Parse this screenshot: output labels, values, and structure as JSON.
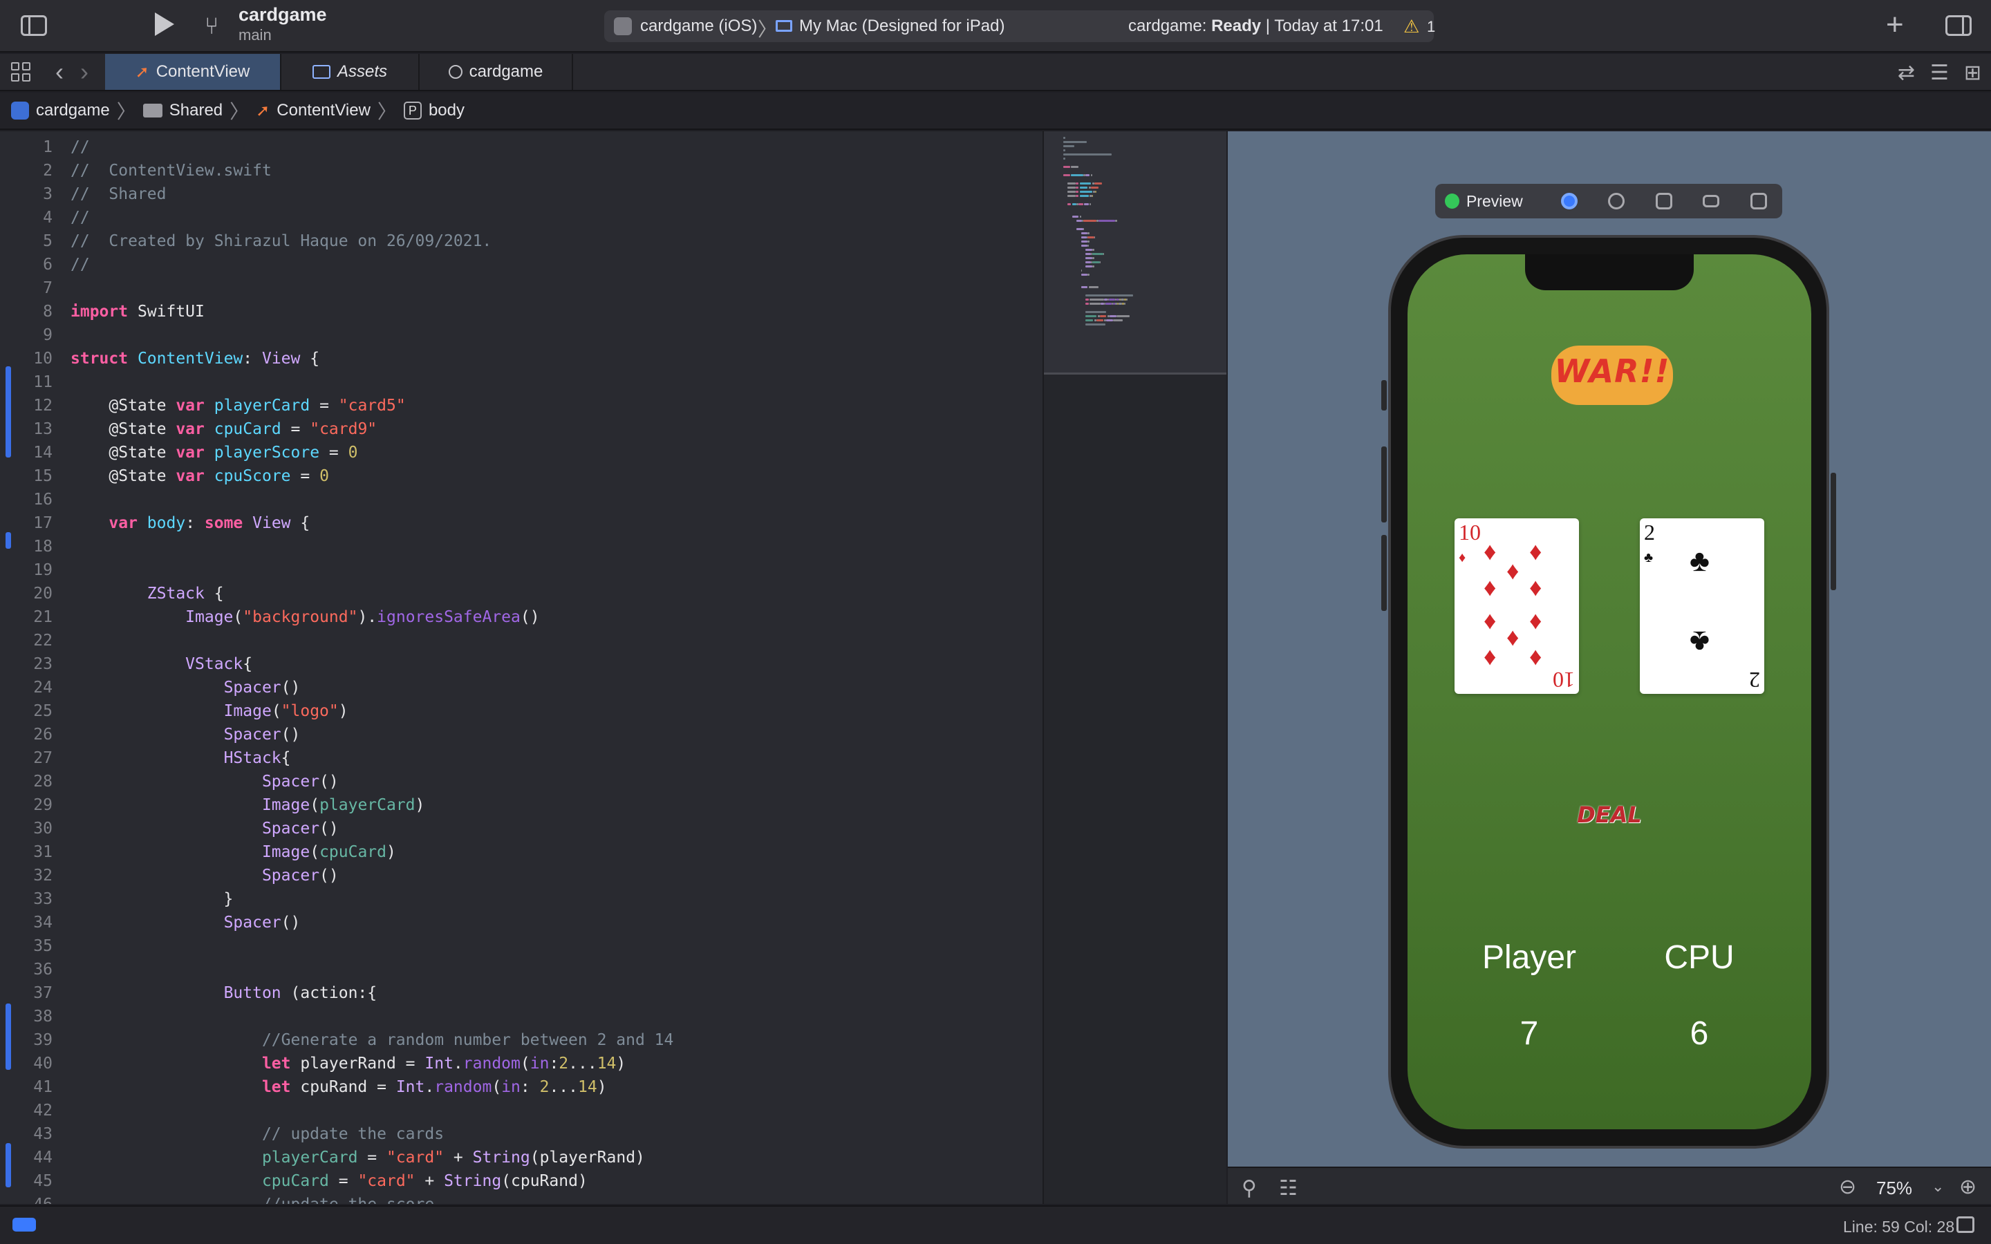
{
  "toolbar": {
    "project": "cardgame",
    "branch": "main",
    "scheme": "cardgame (iOS)",
    "separator": "〉",
    "device": "My Mac (Designed for iPad)",
    "status_prefix": "cardgame: ",
    "status_state": "Ready",
    "status_suffix": " | Today at 17:01",
    "warning_count": "1"
  },
  "tabs": [
    {
      "label": "ContentView",
      "active": true
    },
    {
      "label": "Assets",
      "active": false
    },
    {
      "label": "cardgame",
      "active": false
    }
  ],
  "breadcrumb": [
    "cardgame",
    "Shared",
    "ContentView",
    "body"
  ],
  "breadcrumb_sep": "〉",
  "breadcrumb_p": "P",
  "editor": {
    "lines": [
      [
        {
          "t": "//",
          "c": "cm"
        }
      ],
      [
        {
          "t": "//  ContentView.swift",
          "c": "cm"
        }
      ],
      [
        {
          "t": "//  Shared",
          "c": "cm"
        }
      ],
      [
        {
          "t": "//",
          "c": "cm"
        }
      ],
      [
        {
          "t": "//  Created by Shirazul Haque on 26/09/2021.",
          "c": "cm"
        }
      ],
      [
        {
          "t": "//",
          "c": "cm"
        }
      ],
      [],
      [
        {
          "t": "import",
          "c": "kw"
        },
        {
          "t": " SwiftUI",
          "c": ""
        }
      ],
      [],
      [
        {
          "t": "struct",
          "c": "kw"
        },
        {
          "t": " ",
          "c": ""
        },
        {
          "t": "ContentView",
          "c": "dec"
        },
        {
          "t": ": ",
          "c": ""
        },
        {
          "t": "View",
          "c": "ty"
        },
        {
          "t": " {",
          "c": ""
        }
      ],
      [],
      [
        {
          "t": "    @State ",
          "c": ""
        },
        {
          "t": "var",
          "c": "kw"
        },
        {
          "t": " ",
          "c": ""
        },
        {
          "t": "playerCard",
          "c": "dec"
        },
        {
          "t": " = ",
          "c": ""
        },
        {
          "t": "\"card5\"",
          "c": "str"
        }
      ],
      [
        {
          "t": "    @State ",
          "c": ""
        },
        {
          "t": "var",
          "c": "kw"
        },
        {
          "t": " ",
          "c": ""
        },
        {
          "t": "cpuCard",
          "c": "dec"
        },
        {
          "t": " = ",
          "c": ""
        },
        {
          "t": "\"card9\"",
          "c": "str"
        }
      ],
      [
        {
          "t": "    @State ",
          "c": ""
        },
        {
          "t": "var",
          "c": "kw"
        },
        {
          "t": " ",
          "c": ""
        },
        {
          "t": "playerScore",
          "c": "dec"
        },
        {
          "t": " = ",
          "c": ""
        },
        {
          "t": "0",
          "c": "num"
        }
      ],
      [
        {
          "t": "    @State ",
          "c": ""
        },
        {
          "t": "var",
          "c": "kw"
        },
        {
          "t": " ",
          "c": ""
        },
        {
          "t": "cpuScore",
          "c": "dec"
        },
        {
          "t": " = ",
          "c": ""
        },
        {
          "t": "0",
          "c": "num"
        }
      ],
      [],
      [
        {
          "t": "    ",
          "c": ""
        },
        {
          "t": "var",
          "c": "kw"
        },
        {
          "t": " ",
          "c": ""
        },
        {
          "t": "body",
          "c": "dec"
        },
        {
          "t": ": ",
          "c": ""
        },
        {
          "t": "some",
          "c": "kw"
        },
        {
          "t": " ",
          "c": ""
        },
        {
          "t": "View",
          "c": "ty"
        },
        {
          "t": " {",
          "c": ""
        }
      ],
      [],
      [],
      [
        {
          "t": "        ",
          "c": ""
        },
        {
          "t": "ZStack",
          "c": "ty"
        },
        {
          "t": " {",
          "c": ""
        }
      ],
      [
        {
          "t": "            ",
          "c": ""
        },
        {
          "t": "Image",
          "c": "ty"
        },
        {
          "t": "(",
          "c": ""
        },
        {
          "t": "\"background\"",
          "c": "str"
        },
        {
          "t": ").",
          "c": ""
        },
        {
          "t": "ignoresSafeArea",
          "c": "fn"
        },
        {
          "t": "()",
          "c": ""
        }
      ],
      [],
      [
        {
          "t": "            ",
          "c": ""
        },
        {
          "t": "VStack",
          "c": "ty"
        },
        {
          "t": "{",
          "c": ""
        }
      ],
      [
        {
          "t": "                ",
          "c": ""
        },
        {
          "t": "Spacer",
          "c": "ty"
        },
        {
          "t": "()",
          "c": ""
        }
      ],
      [
        {
          "t": "                ",
          "c": ""
        },
        {
          "t": "Image",
          "c": "ty"
        },
        {
          "t": "(",
          "c": ""
        },
        {
          "t": "\"logo\"",
          "c": "str"
        },
        {
          "t": ")",
          "c": ""
        }
      ],
      [
        {
          "t": "                ",
          "c": ""
        },
        {
          "t": "Spacer",
          "c": "ty"
        },
        {
          "t": "()",
          "c": ""
        }
      ],
      [
        {
          "t": "                ",
          "c": ""
        },
        {
          "t": "HStack",
          "c": "ty"
        },
        {
          "t": "{",
          "c": ""
        }
      ],
      [
        {
          "t": "                    ",
          "c": ""
        },
        {
          "t": "Spacer",
          "c": "ty"
        },
        {
          "t": "()",
          "c": ""
        }
      ],
      [
        {
          "t": "                    ",
          "c": ""
        },
        {
          "t": "Image",
          "c": "ty"
        },
        {
          "t": "(",
          "c": ""
        },
        {
          "t": "playerCard",
          "c": "var"
        },
        {
          "t": ")",
          "c": ""
        }
      ],
      [
        {
          "t": "                    ",
          "c": ""
        },
        {
          "t": "Spacer",
          "c": "ty"
        },
        {
          "t": "()",
          "c": ""
        }
      ],
      [
        {
          "t": "                    ",
          "c": ""
        },
        {
          "t": "Image",
          "c": "ty"
        },
        {
          "t": "(",
          "c": ""
        },
        {
          "t": "cpuCard",
          "c": "var"
        },
        {
          "t": ")",
          "c": ""
        }
      ],
      [
        {
          "t": "                    ",
          "c": ""
        },
        {
          "t": "Spacer",
          "c": "ty"
        },
        {
          "t": "()",
          "c": ""
        }
      ],
      [
        {
          "t": "                }",
          "c": ""
        }
      ],
      [
        {
          "t": "                ",
          "c": ""
        },
        {
          "t": "Spacer",
          "c": "ty"
        },
        {
          "t": "()",
          "c": ""
        }
      ],
      [],
      [],
      [
        {
          "t": "                ",
          "c": ""
        },
        {
          "t": "Button",
          "c": "ty"
        },
        {
          "t": " (action:{",
          "c": ""
        }
      ],
      [],
      [
        {
          "t": "                    //Generate a random number between 2 and 14",
          "c": "cm"
        }
      ],
      [
        {
          "t": "                    ",
          "c": ""
        },
        {
          "t": "let",
          "c": "kw"
        },
        {
          "t": " playerRand = ",
          "c": ""
        },
        {
          "t": "Int",
          "c": "ty"
        },
        {
          "t": ".",
          "c": ""
        },
        {
          "t": "random",
          "c": "fn"
        },
        {
          "t": "(",
          "c": ""
        },
        {
          "t": "in",
          "c": "fn"
        },
        {
          "t": ":",
          "c": ""
        },
        {
          "t": "2",
          "c": "num"
        },
        {
          "t": "...",
          "c": ""
        },
        {
          "t": "14",
          "c": "num"
        },
        {
          "t": ")",
          "c": ""
        }
      ],
      [
        {
          "t": "                    ",
          "c": ""
        },
        {
          "t": "let",
          "c": "kw"
        },
        {
          "t": " cpuRand = ",
          "c": ""
        },
        {
          "t": "Int",
          "c": "ty"
        },
        {
          "t": ".",
          "c": ""
        },
        {
          "t": "random",
          "c": "fn"
        },
        {
          "t": "(",
          "c": ""
        },
        {
          "t": "in",
          "c": "fn"
        },
        {
          "t": ": ",
          "c": ""
        },
        {
          "t": "2",
          "c": "num"
        },
        {
          "t": "...",
          "c": ""
        },
        {
          "t": "14",
          "c": "num"
        },
        {
          "t": ")",
          "c": ""
        }
      ],
      [],
      [
        {
          "t": "                    // update the cards",
          "c": "cm"
        }
      ],
      [
        {
          "t": "                    ",
          "c": ""
        },
        {
          "t": "playerCard",
          "c": "var"
        },
        {
          "t": " = ",
          "c": ""
        },
        {
          "t": "\"card\"",
          "c": "str"
        },
        {
          "t": " + ",
          "c": ""
        },
        {
          "t": "String",
          "c": "ty"
        },
        {
          "t": "(playerRand)",
          "c": ""
        }
      ],
      [
        {
          "t": "                    ",
          "c": ""
        },
        {
          "t": "cpuCard",
          "c": "var"
        },
        {
          "t": " = ",
          "c": ""
        },
        {
          "t": "\"card\"",
          "c": "str"
        },
        {
          "t": " + ",
          "c": ""
        },
        {
          "t": "String",
          "c": "ty"
        },
        {
          "t": "(cpuRand)",
          "c": ""
        }
      ],
      [
        {
          "t": "                    //update the score",
          "c": "cm"
        }
      ]
    ]
  },
  "preview": {
    "label": "Preview",
    "logo_text": "WAR!!",
    "player_card": {
      "rank": "10",
      "suit": "♦"
    },
    "cpu_card": {
      "rank": "2",
      "suit": "♣"
    },
    "deal_label": "DEAL",
    "player_label": "Player",
    "cpu_label": "CPU",
    "player_score": "7",
    "cpu_score": "6"
  },
  "canvas_bar": {
    "zoom": "75%"
  },
  "statusbar": {
    "cursor": "Line: 59  Col: 28"
  },
  "colors": {
    "accent": "#3a7afe",
    "keyword": "#fc5fa3",
    "string": "#fc6a5d",
    "comment": "#7f8c98",
    "felt_green": "#4e7c33"
  },
  "icons": [
    "sidebar-toggle-icon",
    "play-icon",
    "branch-icon",
    "warning-icon",
    "plus-icon",
    "inspector-toggle-icon",
    "grid-icon",
    "chevron-left-icon",
    "chevron-right-icon",
    "swift-icon",
    "assets-icon",
    "clock-icon",
    "pin-icon",
    "adjust-icon",
    "zoom-out-icon",
    "zoom-in-icon"
  ]
}
